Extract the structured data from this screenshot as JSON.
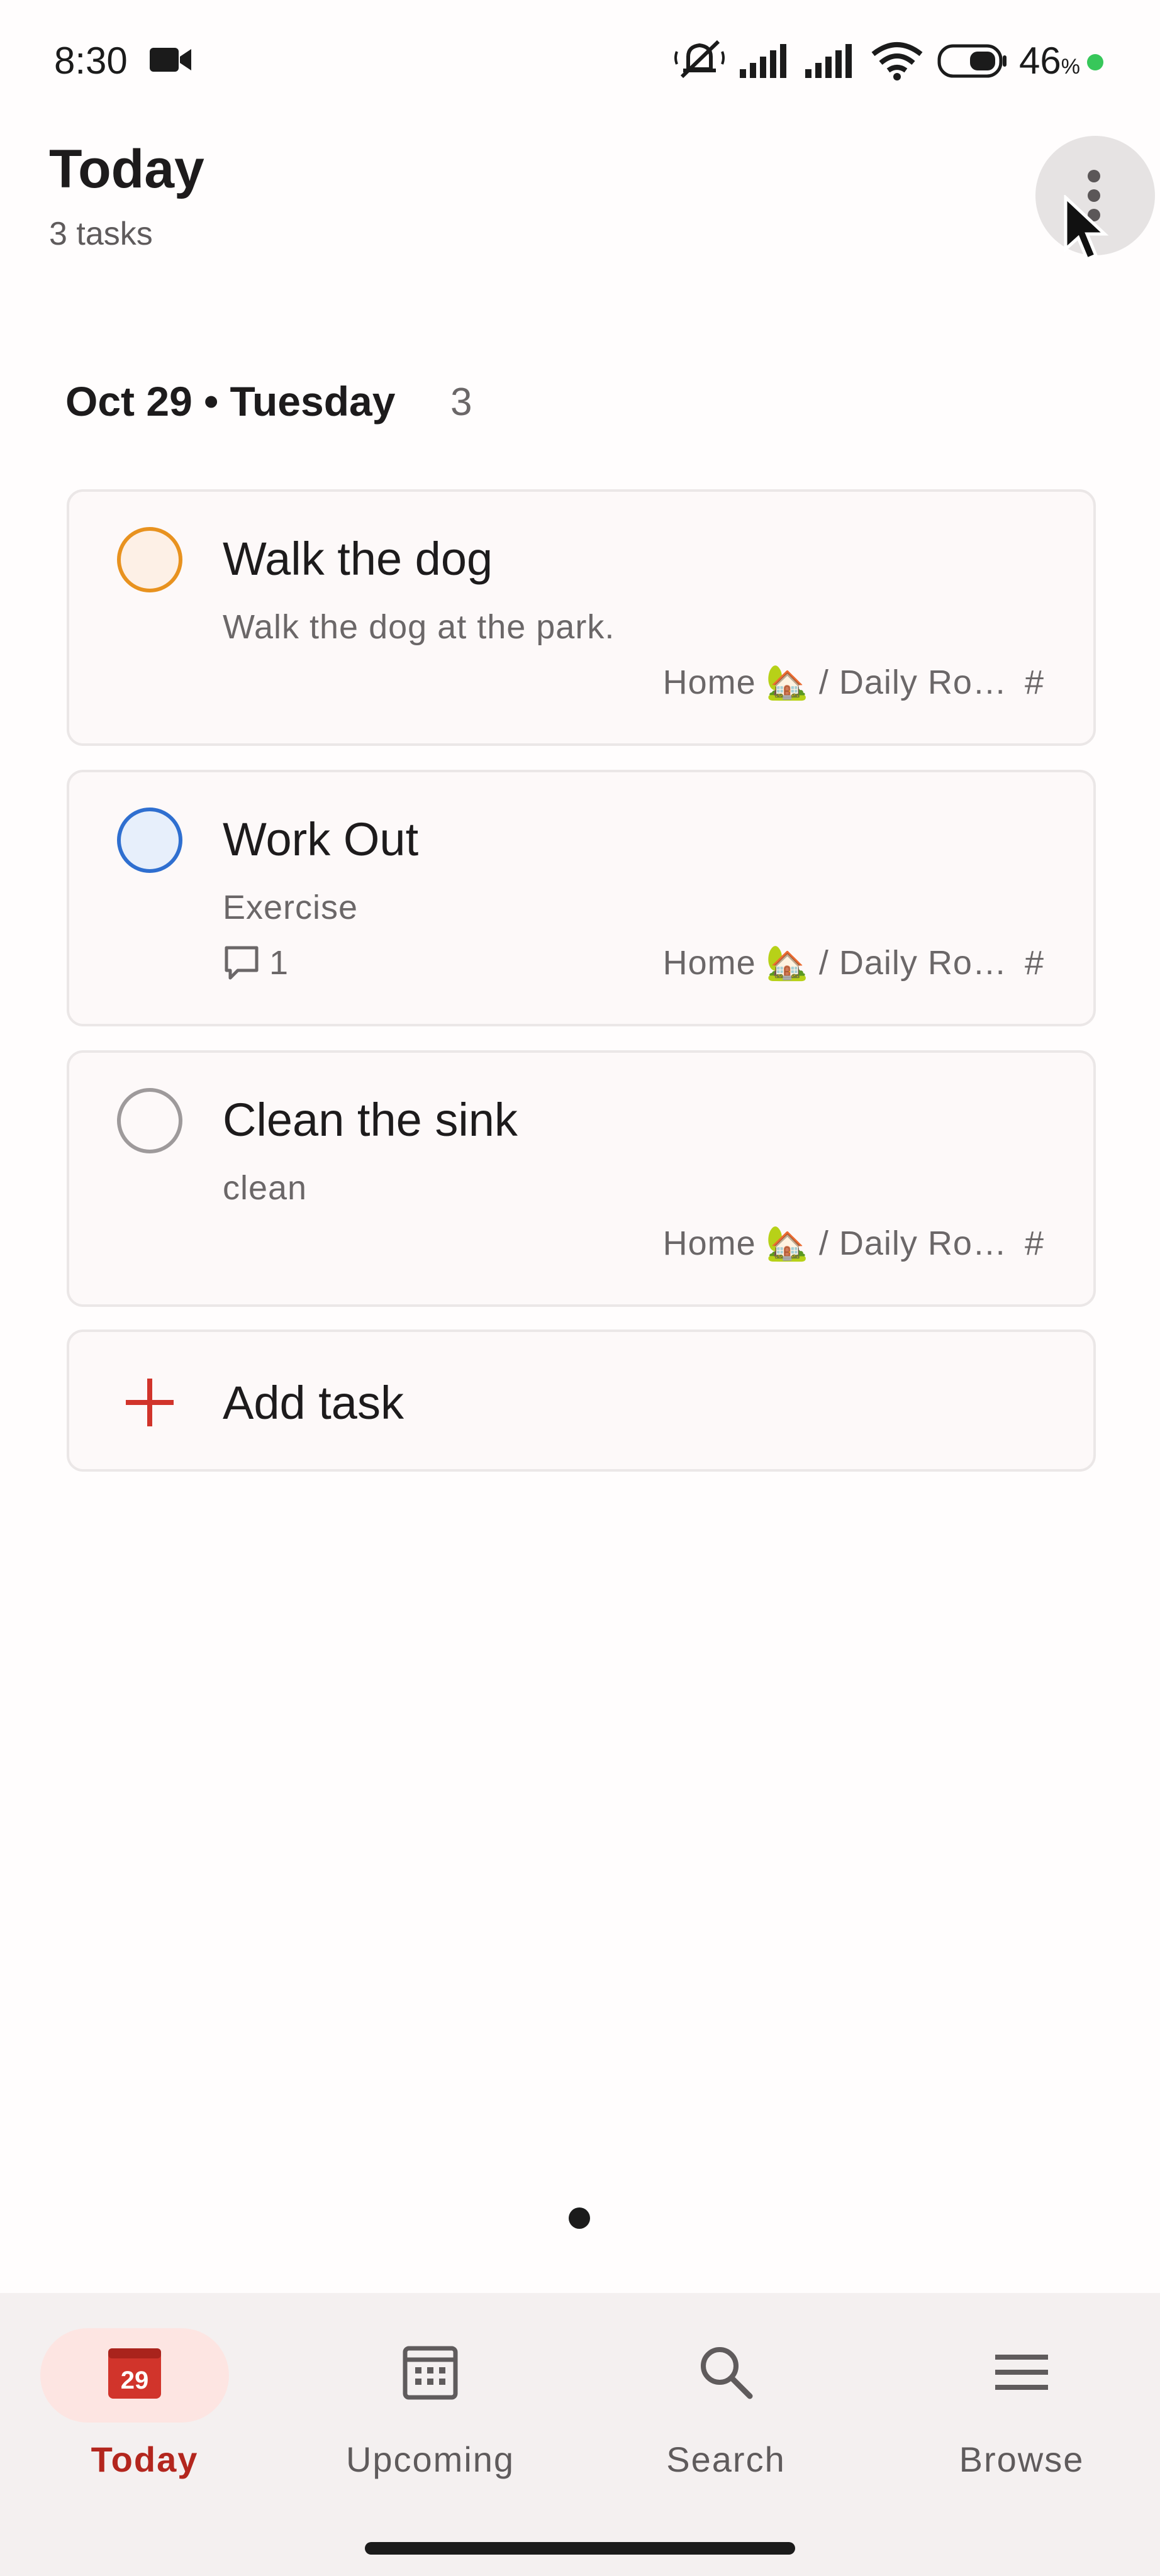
{
  "status_bar": {
    "time": "8:30",
    "battery": "46",
    "battery_unit": "%"
  },
  "header": {
    "title": "Today",
    "subtitle": "3 tasks"
  },
  "section": {
    "title": "Oct 29 • Tuesday",
    "count": "3"
  },
  "tasks": [
    {
      "title": "Walk the dog",
      "description": "Walk the dog at the park.",
      "project": "Home 🏡 / Daily Ro…",
      "project_suffix": "#",
      "priority_color": "#e8921f",
      "fill_color": "#fdf0e6"
    },
    {
      "title": "Work Out",
      "description": "Exercise",
      "comments": "1",
      "project": "Home 🏡 / Daily Ro…",
      "project_suffix": "#",
      "priority_color": "#2f6fd0",
      "fill_color": "#e7effb"
    },
    {
      "title": "Clean the sink",
      "description": "clean",
      "project": "Home 🏡 / Daily Ro…",
      "project_suffix": "#",
      "priority_color": "#9e9a9b",
      "fill_color": "#fdf9f9"
    }
  ],
  "add_task": {
    "label": "Add task",
    "accent": "#d1342b"
  },
  "bottom_nav": {
    "items": [
      {
        "label": "Today",
        "icon": "calendar-day-icon",
        "badge": "29",
        "active": true
      },
      {
        "label": "Upcoming",
        "icon": "calendar-grid-icon",
        "active": false
      },
      {
        "label": "Search",
        "icon": "search-icon",
        "active": false
      },
      {
        "label": "Browse",
        "icon": "menu-icon",
        "active": false
      }
    ]
  },
  "colors": {
    "accent": "#b3261e",
    "active_pill": "#fde5e2"
  }
}
